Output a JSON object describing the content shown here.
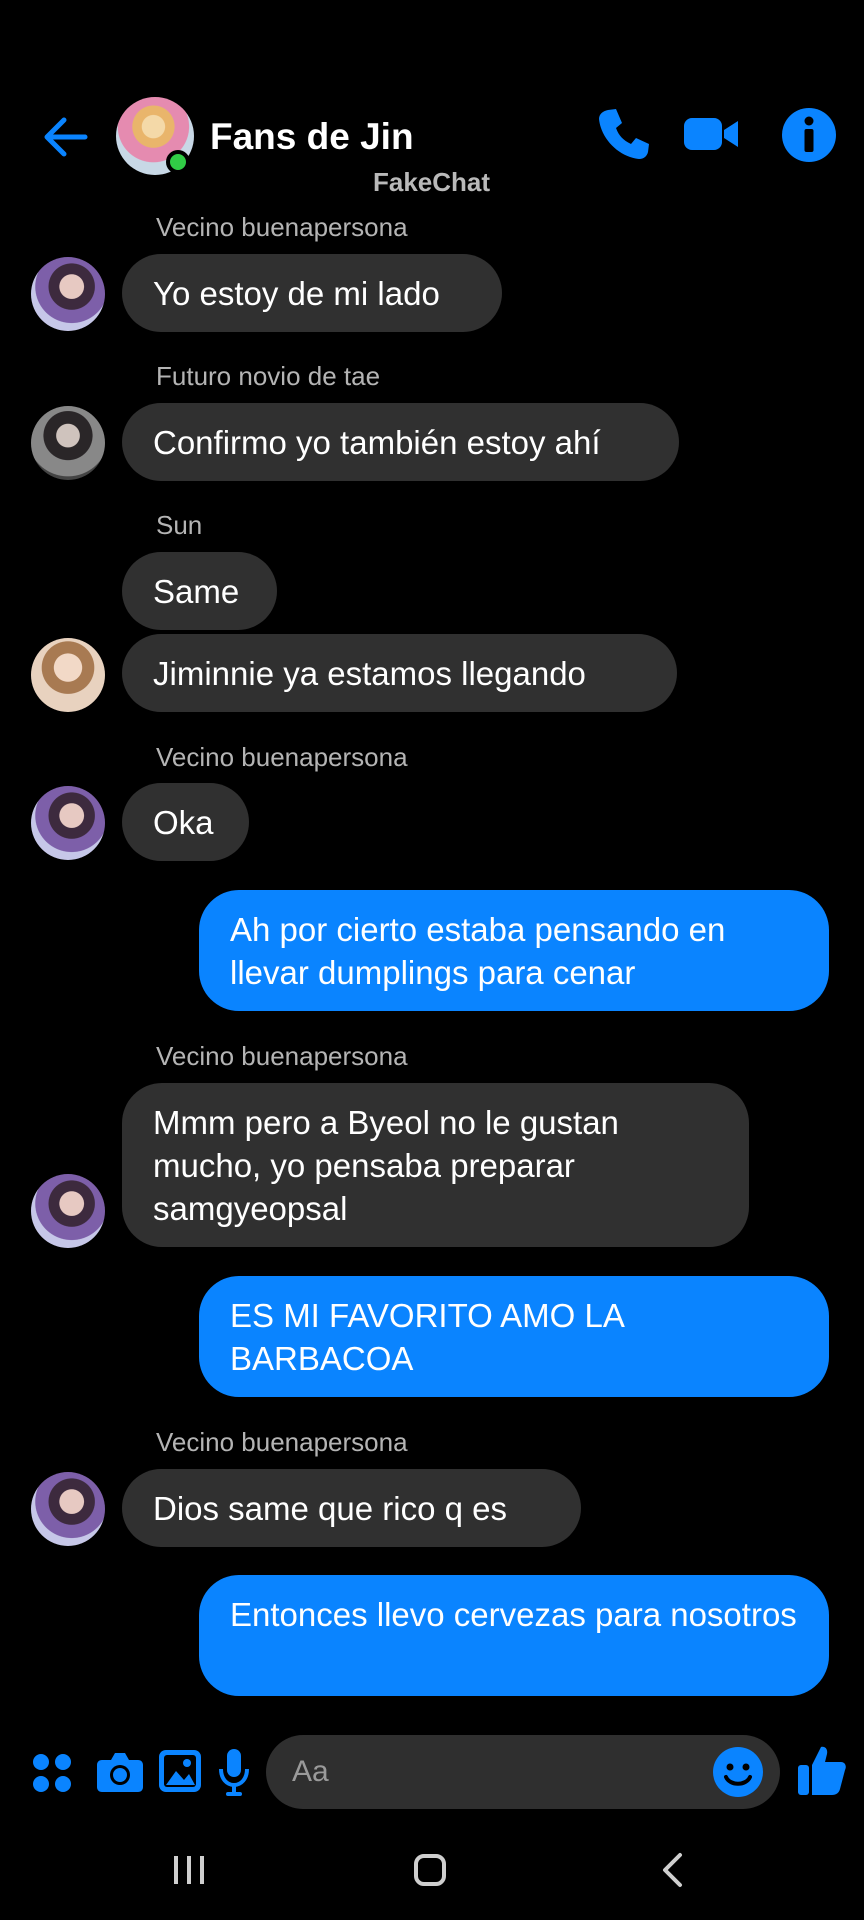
{
  "header": {
    "title": "Fans de Jin",
    "watermark": "FakeChat"
  },
  "colors": {
    "accent": "#0a84ff",
    "incoming_bubble": "#303030",
    "online": "#31cc46"
  },
  "icons": [
    "back-arrow-icon",
    "phone-icon",
    "video-icon",
    "info-icon",
    "apps-icon",
    "camera-icon",
    "gallery-icon",
    "mic-icon",
    "emoji-icon",
    "thumbs-up-icon",
    "recent-apps-icon",
    "home-icon",
    "nav-back-icon"
  ],
  "messages": [
    {
      "sender": "Vecino buenapersona",
      "text": "Yo estoy de mi lado",
      "direction": "incoming"
    },
    {
      "sender": "Futuro novio de tae",
      "text": "Confirmo yo también estoy ahí",
      "direction": "incoming"
    },
    {
      "sender": "Sun",
      "text": "Same",
      "direction": "incoming"
    },
    {
      "sender": "",
      "text": "Jiminnie ya estamos llegando",
      "direction": "incoming"
    },
    {
      "sender": "Vecino buenapersona",
      "text": "Oka",
      "direction": "incoming"
    },
    {
      "sender": "",
      "text": "Ah por cierto estaba pensando en llevar dumplings para cenar",
      "direction": "outgoing"
    },
    {
      "sender": "Vecino buenapersona",
      "text": "Mmm pero a Byeol no le gustan mucho, yo pensaba preparar samgyeopsal",
      "direction": "incoming"
    },
    {
      "sender": "",
      "text": "ES MI FAVORITO AMO LA BARBACOA",
      "direction": "outgoing"
    },
    {
      "sender": "Vecino buenapersona",
      "text": "Dios same que rico q es",
      "direction": "incoming"
    },
    {
      "sender": "",
      "text": "Entonces llevo cervezas para nosotros",
      "direction": "outgoing"
    }
  ],
  "composer": {
    "placeholder": "Aa"
  }
}
